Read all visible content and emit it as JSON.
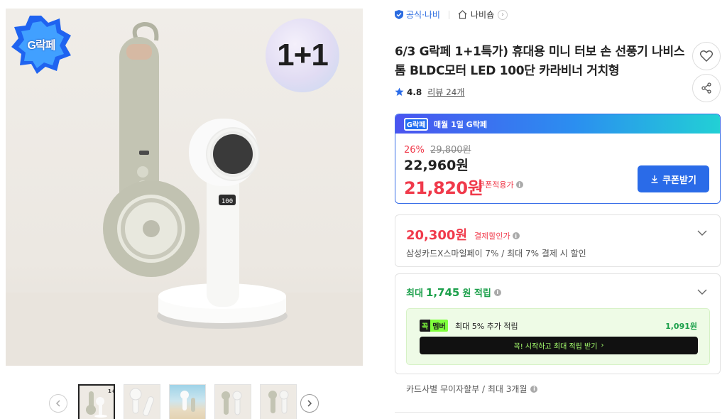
{
  "gallery": {
    "promo_badge": "G락페",
    "bundle_badge": "1+1",
    "thumbnail_count": 5,
    "display_digits": "100"
  },
  "brand": {
    "official_label": "공식·나비",
    "store_name": "나비숍"
  },
  "product": {
    "title": "6/3 G락페 1+1특가) 휴대용 미니 터보 손 선풍기 나비스톰 BLDC모터 LED 100단 카라비너 거치형",
    "rating": "4.8",
    "reviews": "리뷰 24개"
  },
  "price_box": {
    "banner_logo": "G락페",
    "banner_text": "매월 1일 G락페",
    "discount_percent": "26%",
    "original_price": "29,800원",
    "sale_price": "22,960원",
    "coupon_price": "21,820원",
    "coupon_label": "쿠폰적용가",
    "coupon_button": "쿠폰받기"
  },
  "card_discount": {
    "price": "20,300원",
    "label": "결제할인가",
    "description": "삼성카드X스마일페이 7% / 최대 7% 결제 시 할인"
  },
  "points": {
    "prefix": "최대",
    "amount": "1,745",
    "suffix": "원 적립",
    "member_logo_left": "꼭",
    "member_logo_right": "멤버",
    "member_text": "최대 5% 추가 적립",
    "member_points": "1,091원",
    "member_cta": "꼭! 시작하고 최대 적립 받기"
  },
  "installment": {
    "text": "카드사별 무이자할부 / 최대 3개월"
  },
  "colors": {
    "accent_blue": "#2a6be8",
    "price_red": "#f03a4b",
    "point_green": "#1ca04b"
  }
}
